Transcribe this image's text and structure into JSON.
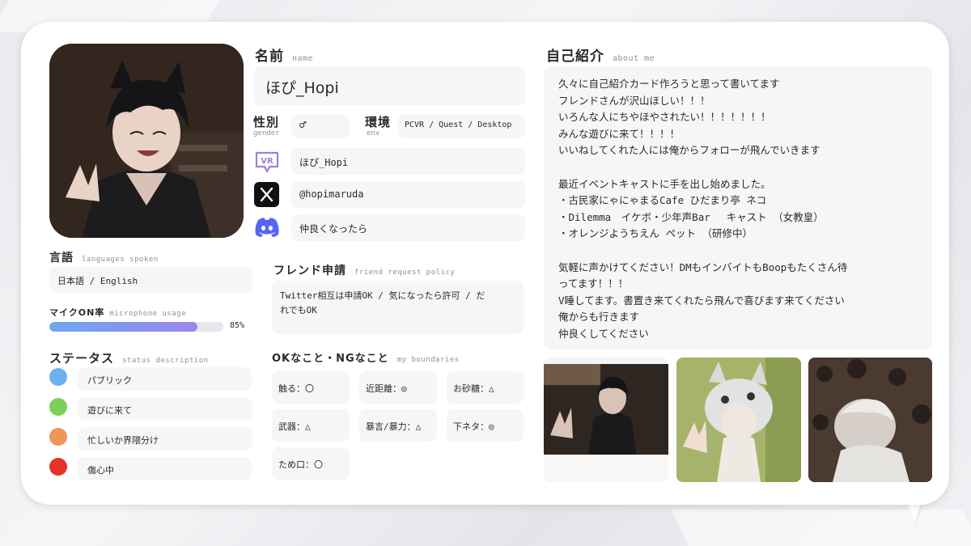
{
  "name": {
    "heading": "名前",
    "sub": "name",
    "value": "ほぴ_Hopi"
  },
  "gender": {
    "heading": "性別",
    "sub": "gender",
    "value": "♂"
  },
  "env": {
    "heading": "環境",
    "sub": "env",
    "value": "PCVR / Quest / Desktop"
  },
  "socials": {
    "vrchat": {
      "icon": "vrchat-icon",
      "value": "ほぴ_Hopi"
    },
    "x": {
      "icon": "x-icon",
      "value": "@hopimaruda"
    },
    "discord": {
      "icon": "discord-icon",
      "value": "仲良くなったら"
    }
  },
  "languages": {
    "heading": "言語",
    "sub": "languages spoken",
    "value": "日本語 / English"
  },
  "mic": {
    "heading": "マイクON率",
    "sub": "microphone usage",
    "value": 85,
    "label": "85%"
  },
  "status": {
    "heading": "ステータス",
    "sub": "status description",
    "items": [
      {
        "label": "パブリック",
        "color": "#6fb0ee"
      },
      {
        "label": "遊びに来て",
        "color": "#7bd05a"
      },
      {
        "label": "忙しいか界隈分け",
        "color": "#f0945a"
      },
      {
        "label": "傷心中",
        "color": "#e3332b"
      }
    ]
  },
  "friend_request": {
    "heading": "フレンド申請",
    "sub": "friend request policy",
    "lines": [
      "Twitter相互は申請OK / 気になったら許可 / だ",
      "れでもOK"
    ]
  },
  "boundaries": {
    "heading": "OKなこと・NGなこと",
    "sub": "my boundaries",
    "items": [
      "触る：〇",
      "近距離：◎",
      "お砂糖：△",
      "武器：△",
      "暴言/暴力：△",
      "下ネタ：◎",
      "ため口：〇"
    ]
  },
  "about": {
    "heading": "自己紹介",
    "sub": "about me",
    "lines": [
      "久々に自己紹介カード作ろうと思って書いてます",
      "フレンドさんが沢山ほしい！！！",
      "いろんな人にちやほやされたい！！！！！！！",
      "みんな遊びに来て！！！！",
      "いいねしてくれた人には俺からフォローが飛んでいきます",
      "",
      "最近イベントキャストに手を出し始めました。",
      "・古民家にゃにゃまるCafe ひだまり亭 ネコ",
      "・Dilemma　イケボ・少年声Bar　 キャスト （女教皇）",
      "・オレンジようちえん ペット （研修中）",
      "",
      "気軽に声かけてください！DMもインバイトもBoopもたくさん待",
      "ってます！！！",
      "V睡してます。書置き来てくれたら飛んで喜びます来てください",
      "俺からも行きます",
      "仲良くしてください"
    ]
  }
}
